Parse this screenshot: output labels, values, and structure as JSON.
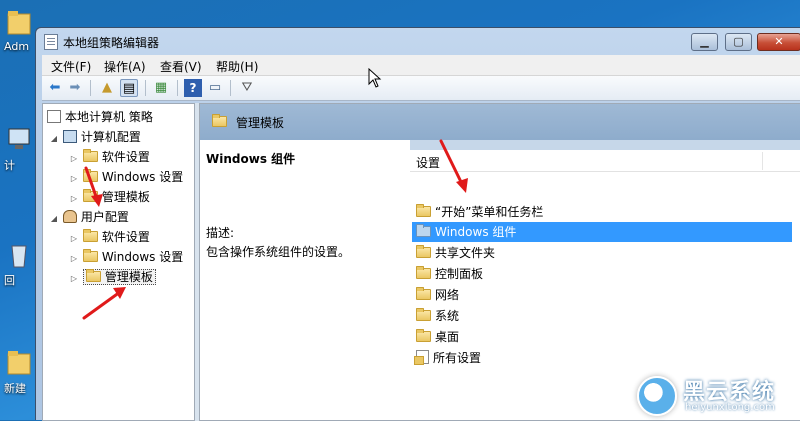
{
  "desktop": {
    "icons": [
      {
        "label": "Adm"
      },
      {
        "label": "计"
      },
      {
        "label": "回"
      },
      {
        "label": "新建"
      }
    ]
  },
  "window": {
    "title": "本地组策略编辑器",
    "controls": {
      "minimize": "▁",
      "maximize": "▢",
      "close": "✕"
    }
  },
  "menu": {
    "items": [
      "文件(F)",
      "操作(A)",
      "查看(V)",
      "帮助(H)"
    ]
  },
  "tree": {
    "root": "本地计算机 策略",
    "computer_config": "计算机配置",
    "computer_children": [
      "软件设置",
      "Windows 设置",
      "管理模板"
    ],
    "user_config": "用户配置",
    "user_children": [
      "软件设置",
      "Windows 设置",
      "管理模板"
    ]
  },
  "right": {
    "path_title": "管理模板",
    "desc_title": "Windows 组件",
    "desc_label": "描述:",
    "desc_body": "包含操作系统组件的设置。",
    "column_header": "设置",
    "items": [
      "“开始”菜单和任务栏",
      "Windows 组件",
      "共享文件夹",
      "控制面板",
      "网络",
      "系统",
      "桌面",
      "所有设置"
    ],
    "selected_index": 1
  },
  "watermark": {
    "name": "黑云系统",
    "url": "heiyunxitong.com"
  }
}
